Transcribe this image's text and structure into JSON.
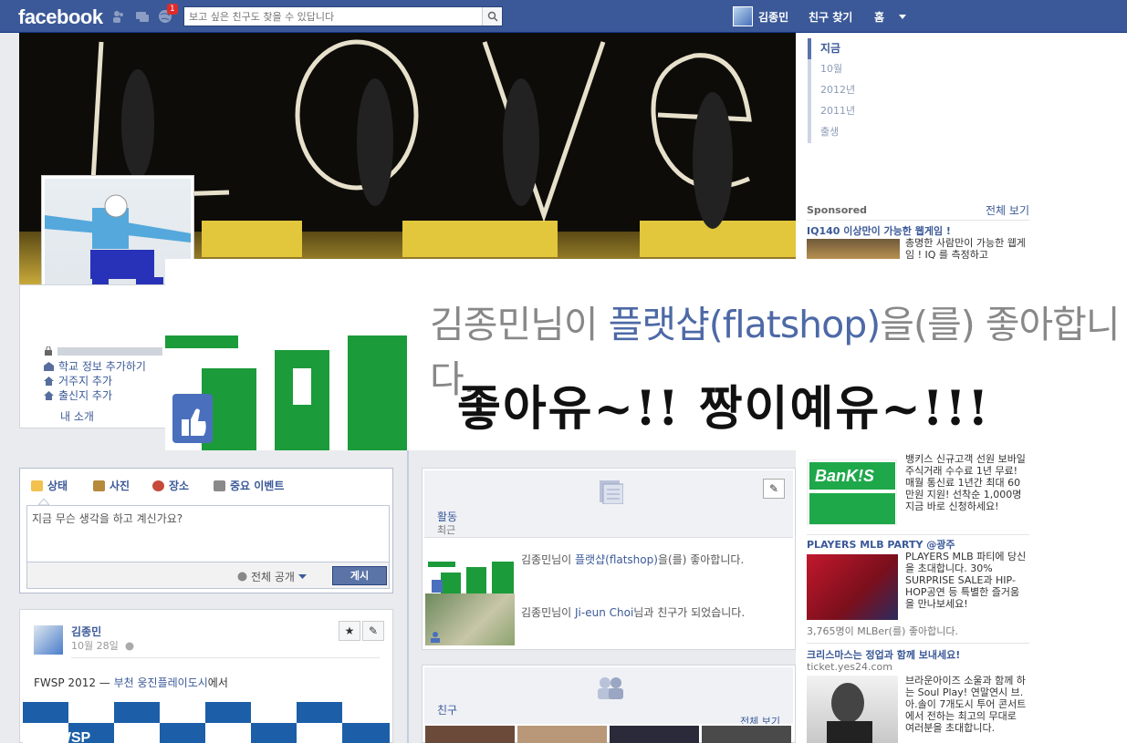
{
  "topbar": {
    "logo": "facebook",
    "notification_count": "1",
    "search_placeholder": "보고 싶은 친구도 찾을 수 있답니다",
    "user_name": "김종민",
    "find_friends": "친구 찾기",
    "home": "홈"
  },
  "about": {
    "items": [
      "학교 정보 추가하기",
      "거주지 추가",
      "출신지 추가"
    ],
    "intro": "내 소개"
  },
  "timeline_nav": [
    "지금",
    "10월",
    "2012년",
    "2011년",
    "출생"
  ],
  "sidebar": {
    "sponsored": "Sponsored",
    "see_all": "전체 보기",
    "ads": [
      {
        "title": "IQ140 이상만이 가능한 웹게임 !",
        "body": "총명한 사람만이 가능한 웹게임 ! IQ 를 측정하고"
      },
      {
        "title": "",
        "body": "뱅키스 신규고객 선원 보바일 주식거래 수수료 1년 무료! 매월 통신료 1년간 최대 60만원 지원! 선착순 1,000명 지금 바로 신청하세요!",
        "logo": "BanK!S"
      },
      {
        "title": "PLAYERS MLB PARTY @광주",
        "body": "PLAYERS MLB 파티에 당신을 초대합니다. 30% SURPRISE SALE과 HIP-HOP공연 등 특별한 즐거움을 만나보세요!",
        "likes": "3,765명이 MLBer(를) 좋아합니다."
      },
      {
        "title": "크리스마스는 정업과 함께 보내세요!",
        "source": "ticket.yes24.com",
        "body": "브라운아이즈 소울과 함께 하는 Soul Play! 연말연시 브.아.솔이 7개도시 투어 콘서트에서 전하는 최고의 무대로 여러분을 초대합니다."
      }
    ]
  },
  "overlay": {
    "line1_pre": "김종민님이 ",
    "line1_link": "플랫샵(flatshop)",
    "line1_post": "을(를) 좋아합니다.",
    "line2": "좋아유~!! 짱이예유~!!!"
  },
  "composer": {
    "tabs": [
      "상태",
      "사진",
      "장소",
      "중요 이벤트"
    ],
    "placeholder": "지금 무슨 생각을 하고 계신가요?",
    "privacy": "전체 공개",
    "post_button": "게시"
  },
  "post": {
    "author": "김종민",
    "date": "10월 28일",
    "text_pre": "FWSP 2012 — ",
    "text_link": "부천 웅진플레이도시",
    "text_post": "에서",
    "banner_text": "FWSP"
  },
  "activity": {
    "title": "활동",
    "subtitle": "최근",
    "row1_pre": "김종민님이 ",
    "row1_link": "플랫샵(flatshop)",
    "row1_post": "을(를) 좋아합니다.",
    "row2_pre": "김종민님이 ",
    "row2_link": "Ji-eun Choi",
    "row2_post": "님과 친구가 되었습니다."
  },
  "friends": {
    "title": "친구",
    "see_all": "전체 보기"
  },
  "colors": {
    "brand_blue": "#3b5998",
    "flatshop_green": "#1c9b3a",
    "badge_red": "#e02a2a"
  }
}
